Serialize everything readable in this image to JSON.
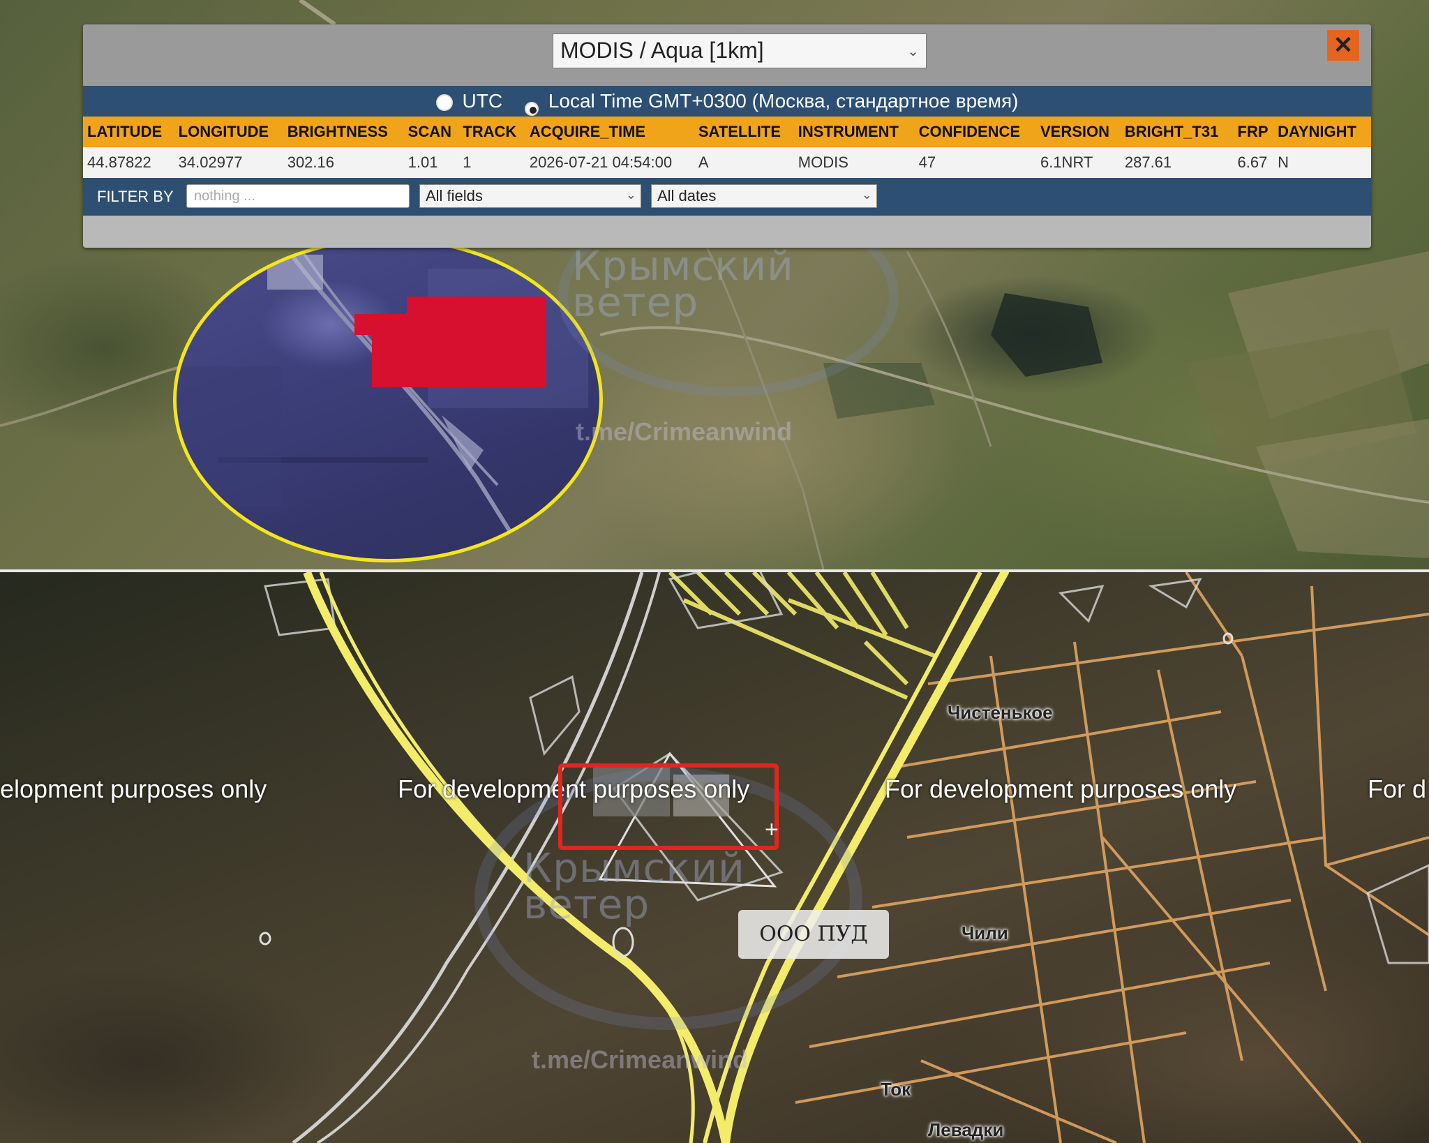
{
  "popup": {
    "satellite_select": "MODIS / Aqua [1km]",
    "close_label": "✕",
    "timezone": {
      "utc_label": "UTC",
      "local_label": "Local Time GMT+0300 (Москва, стандартное время)",
      "selected": "local"
    },
    "columns": [
      "LATITUDE",
      "LONGITUDE",
      "BRIGHTNESS",
      "SCAN",
      "TRACK",
      "ACQUIRE_TIME",
      "SATELLITE",
      "INSTRUMENT",
      "CONFIDENCE",
      "VERSION",
      "BRIGHT_T31",
      "FRP",
      "DAYNIGHT"
    ],
    "row": [
      "44.87822",
      "34.02977",
      "302.16",
      "1.01",
      "1",
      "2026-07-21 04:54:00",
      "A",
      "MODIS",
      "47",
      "6.1NRT",
      "287.61",
      "6.67",
      "N"
    ],
    "filter": {
      "label": "FILTER BY",
      "placeholder": "nothing ...",
      "field_select": "All fields",
      "date_select": "All dates"
    }
  },
  "watermark": {
    "name_line1": "Крымский",
    "name_line2": "ветер",
    "link": "t.me/Crimeanwind"
  },
  "bottom_map": {
    "dev_text": [
      "elopment purposes only",
      "For development purposes only",
      "For development purposes only",
      "For d"
    ],
    "places": {
      "chistenkoe": "Чистенькое",
      "chili": "Чили",
      "tok": "Ток",
      "levadki": "Левадки"
    },
    "company_label": "ООО ПУД"
  },
  "colors": {
    "fire_red": "#d6102e",
    "zoom_ring": "#f4e61c",
    "header_orange": "#f0a41a",
    "bar_blue": "#2c4f73",
    "highlight_red": "#e0261d",
    "major_road": "#f2ec6a",
    "minor_road": "#e0a460"
  }
}
